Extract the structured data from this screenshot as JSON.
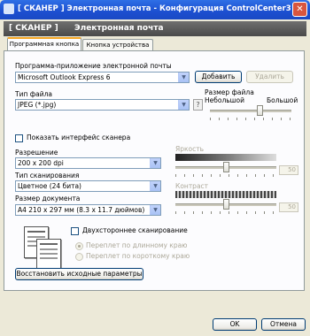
{
  "window": {
    "title": "[ СКАНЕР ]  Электронная почта - Конфигурация ControlCenter3",
    "close_symbol": "✕"
  },
  "header": {
    "scanner": "[ СКАНЕР ]",
    "section": "Электронная почта"
  },
  "tabs": [
    {
      "label": "Программная кнопка",
      "active": true
    },
    {
      "label": "Кнопка устройства",
      "active": false
    }
  ],
  "email_app": {
    "label": "Программа-приложение электронной почты",
    "value": "Microsoft Outlook Express 6",
    "add_button": "Добавить",
    "remove_button": "Удалить"
  },
  "file_type": {
    "label": "Тип файла",
    "value": "JPEG (*.jpg)"
  },
  "file_size": {
    "label": "Размер файла",
    "min_label": "Небольшой",
    "max_label": "Большой",
    "level": 0.6
  },
  "show_scanner_interface": {
    "label": "Показать интерфейс сканера",
    "checked": false
  },
  "resolution": {
    "label": "Разрешение",
    "value": "200 x 200 dpi"
  },
  "scan_type": {
    "label": "Тип сканирования",
    "value": "Цветное (24 бита)"
  },
  "document_size": {
    "label": "Размер документа",
    "value": "A4 210 x 297 мм (8.3 x 11.7 дюймов)"
  },
  "brightness": {
    "label": "Яркость",
    "value": "50"
  },
  "contrast": {
    "label": "Контраст",
    "value": "50"
  },
  "duplex": {
    "label": "Двухстороннее сканирование",
    "checked": false,
    "options": [
      {
        "label": "Переплет по длинному краю",
        "selected": true
      },
      {
        "label": "Переплет по короткому краю",
        "selected": false
      }
    ]
  },
  "restore_button": "Восстановить исходные параметры",
  "ok_button": "OK",
  "cancel_button": "Отмена",
  "icons": {
    "dropdown": "▼",
    "help": "?"
  }
}
